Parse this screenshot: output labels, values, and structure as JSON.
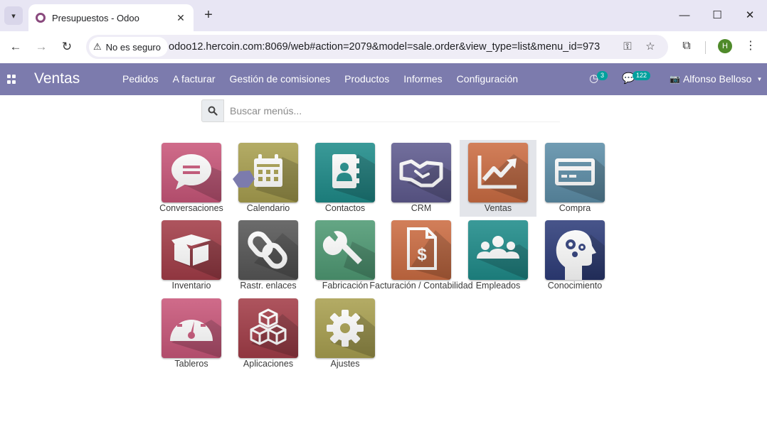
{
  "browser": {
    "tab_title": "Presupuestos - Odoo",
    "tab_close": "✕",
    "new_tab": "+",
    "security_label": "No es seguro",
    "url": "odoo12.hercoin.com:8069/web#action=2079&model=sale.order&view_type=list&menu_id=973",
    "profile_initial": "H",
    "icons": [
      "tab-search-icon",
      "back-icon",
      "forward-icon",
      "reload-icon",
      "warning-icon",
      "key-icon",
      "star-icon",
      "extensions-icon",
      "menu-dots-icon",
      "minimize-icon",
      "maximize-icon",
      "close-icon"
    ]
  },
  "navbar": {
    "app_title": "Ventas",
    "menu": [
      "Pedidos",
      "A facturar",
      "Gestión de comisiones",
      "Productos",
      "Informes",
      "Configuración"
    ],
    "activity_count": "3",
    "messages_count": "122",
    "user_name": "Alfonso Belloso",
    "accent_color": "#7c7bad",
    "badge_color": "#00a09d"
  },
  "search": {
    "placeholder": "Buscar menús..."
  },
  "apps": [
    {
      "label": "Conversaciones",
      "icon": "chat-bubble-icon",
      "color": "#c9577a"
    },
    {
      "label": "Calendario",
      "icon": "calendar-icon",
      "color": "#a9a050"
    },
    {
      "label": "Contactos",
      "icon": "address-book-icon",
      "color": "#1f8c8a"
    },
    {
      "label": "CRM",
      "icon": "handshake-icon",
      "color": "#5f5b8f"
    },
    {
      "label": "Ventas",
      "icon": "trending-up-icon",
      "color": "#cc6d43",
      "selected": true
    },
    {
      "label": "Compra",
      "icon": "credit-card-icon",
      "color": "#5d8ea8"
    },
    {
      "label": "Inventario",
      "icon": "box-icon",
      "color": "#a33d48"
    },
    {
      "label": "Rastr. enlaces",
      "icon": "link-icon",
      "color": "#575757"
    },
    {
      "label": "Fabricación",
      "icon": "wrench-icon",
      "color": "#4f9a74"
    },
    {
      "label": "Facturación / Contabilidad",
      "icon": "invoice-icon",
      "color": "#cc6d43"
    },
    {
      "label": "Empleados",
      "icon": "people-icon",
      "color": "#1f8c8a"
    },
    {
      "label": "Conocimiento",
      "icon": "head-gears-icon",
      "color": "#2e3d7a"
    },
    {
      "label": "Tableros",
      "icon": "dashboard-icon",
      "color": "#c9577a"
    },
    {
      "label": "Aplicaciones",
      "icon": "cubes-icon",
      "color": "#a33d48"
    },
    {
      "label": "Ajustes",
      "icon": "gear-icon",
      "color": "#a9a050"
    }
  ]
}
